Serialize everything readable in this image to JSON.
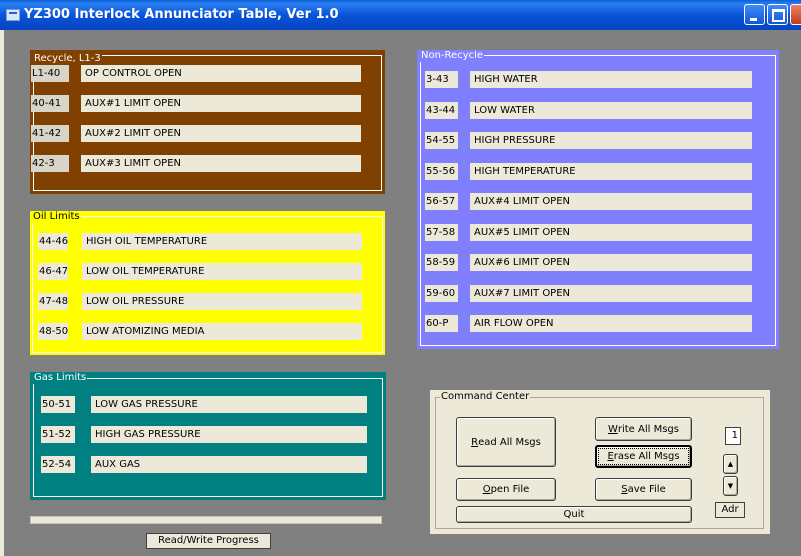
{
  "window": {
    "title": "YZ300 Interlock Annunciator Table, Ver 1.0"
  },
  "recycle": {
    "legend": "Recycle, L1-3",
    "rows": [
      {
        "code": "L1-40",
        "msg": "OP CONTROL OPEN"
      },
      {
        "code": "40-41",
        "msg": "AUX#1 LIMIT OPEN"
      },
      {
        "code": "41-42",
        "msg": "AUX#2 LIMIT OPEN"
      },
      {
        "code": "42-3",
        "msg": "AUX#3 LIMIT OPEN"
      }
    ]
  },
  "oil": {
    "legend": "Oil Limits",
    "rows": [
      {
        "code": "44-46",
        "msg": "HIGH OIL TEMPERATURE"
      },
      {
        "code": "46-47",
        "msg": "LOW OIL TEMPERATURE"
      },
      {
        "code": "47-48",
        "msg": "LOW OIL PRESSURE"
      },
      {
        "code": "48-50",
        "msg": "LOW ATOMIZING MEDIA"
      }
    ]
  },
  "gas": {
    "legend": "Gas Limits",
    "rows": [
      {
        "code": "50-51",
        "msg": "LOW GAS PRESSURE"
      },
      {
        "code": "51-52",
        "msg": "HIGH GAS PRESSURE"
      },
      {
        "code": "52-54",
        "msg": "AUX GAS"
      }
    ]
  },
  "nonrecycle": {
    "legend": "Non-Recycle",
    "rows": [
      {
        "code": "3-43",
        "msg": "HIGH WATER"
      },
      {
        "code": "43-44",
        "msg": "LOW WATER"
      },
      {
        "code": "54-55",
        "msg": "HIGH PRESSURE"
      },
      {
        "code": "55-56",
        "msg": "HIGH TEMPERATURE"
      },
      {
        "code": "56-57",
        "msg": "AUX#4 LIMIT OPEN"
      },
      {
        "code": "57-58",
        "msg": "AUX#5 LIMIT OPEN"
      },
      {
        "code": "58-59",
        "msg": "AUX#6 LIMIT OPEN"
      },
      {
        "code": "59-60",
        "msg": "AUX#7 LIMIT OPEN"
      },
      {
        "code": "60-P",
        "msg": "AIR FLOW OPEN"
      }
    ]
  },
  "command": {
    "legend": "Command Center",
    "read_all": {
      "pre": "",
      "u": "R",
      "post": "ead All Msgs"
    },
    "write_all": {
      "pre": "",
      "u": "W",
      "post": "rite All Msgs"
    },
    "erase_all": {
      "pre": "",
      "u": "E",
      "post": "rase All Msgs"
    },
    "open_file": {
      "pre": "",
      "u": "O",
      "post": "pen File"
    },
    "save_file": {
      "pre": "",
      "u": "S",
      "post": "ave File"
    },
    "quit": "Quit",
    "address_value": "1",
    "address_label": "Adr",
    "spin_up": "▲",
    "spin_down": "▼"
  },
  "progress": {
    "label": "Read/Write Progress",
    "value": 0
  },
  "colors": {
    "recycle": "#804000",
    "oil": "#ffff00",
    "gas": "#008080",
    "nonrecycle": "#8080ff",
    "field": "#ece9d8"
  }
}
